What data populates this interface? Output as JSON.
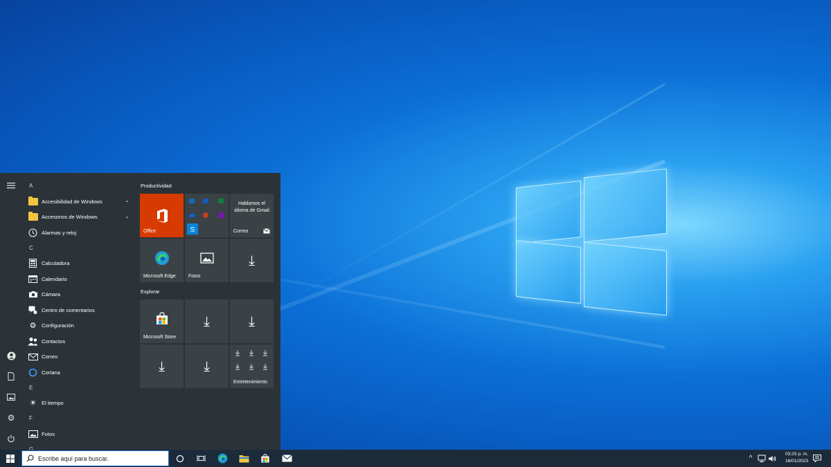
{
  "desktop": {
    "wallpaper": "windows-10-hero"
  },
  "start_menu": {
    "rail": [
      {
        "icon": "hamburger-icon"
      },
      {
        "icon": "user-icon"
      },
      {
        "icon": "document-icon"
      },
      {
        "icon": "pictures-icon"
      },
      {
        "icon": "settings-icon"
      },
      {
        "icon": "power-icon"
      }
    ],
    "letters": {
      "a": "A",
      "c": "C",
      "e": "E",
      "f": "F",
      "g": "G"
    },
    "apps": {
      "accesibilidad": "Accesibilidad de Windows",
      "accesorios": "Accesorios de Windows",
      "alarmas": "Alarmas y reloj",
      "calculadora": "Calculadora",
      "calendario": "Calendario",
      "camara": "Cámara",
      "centro": "Centro de comentarios",
      "configuracion": "Configuración",
      "contactos": "Contactos",
      "correo": "Correo",
      "cortana": "Cortana",
      "tiempo": "El tiempo",
      "fotos": "Fotos"
    },
    "groups": {
      "productividad": "Productividad",
      "explorar": "Explorar"
    },
    "tiles": {
      "office": "Office",
      "gmail_text": "Hablamos el idioma de Gmail",
      "correo": "Correo",
      "edge": "Microsoft Edge",
      "fotos": "Fotos",
      "store": "Microsoft Store",
      "entretenimiento": "Entretenimiento"
    }
  },
  "taskbar": {
    "search_placeholder": "Escribe aquí para buscar.",
    "time": "03:25 p. m.",
    "date": "16/01/2023",
    "accent": "#d83b01"
  }
}
